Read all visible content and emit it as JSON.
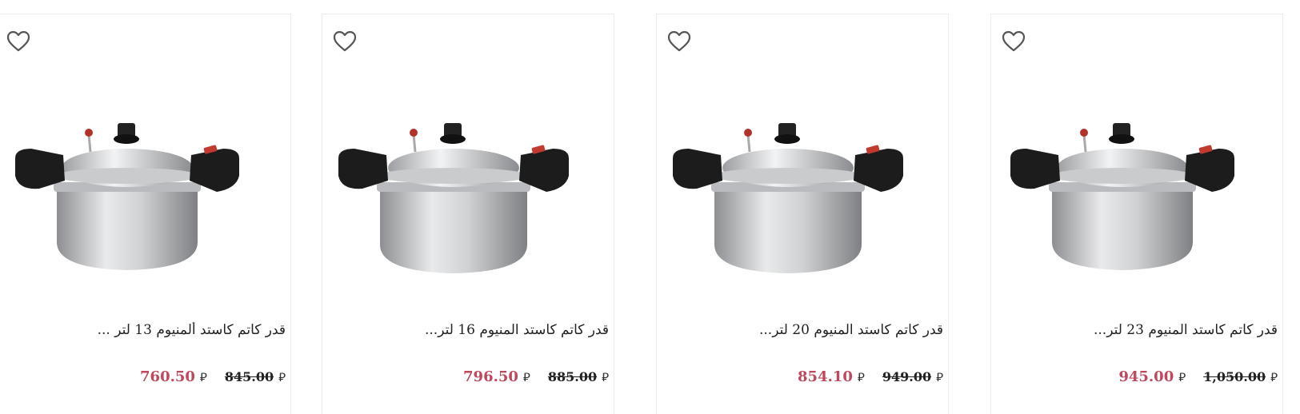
{
  "currency_symbol": "⃁",
  "products": [
    {
      "title": "قدر كاتم كاستد المنيوم 23 لتر...",
      "old_price": "1,050.00",
      "new_price": "945.00"
    },
    {
      "title": "قدر كاتم كاستد المنيوم 20 لتر...",
      "old_price": "949.00",
      "new_price": "854.10"
    },
    {
      "title": "قدر كاتم كاستد المنيوم 16 لتر...",
      "old_price": "885.00",
      "new_price": "796.50"
    },
    {
      "title": "قدر كاتم كاستد ألمنيوم 13 لتر ...",
      "old_price": "845.00",
      "new_price": "760.50"
    }
  ],
  "icons": {
    "wishlist": "heart-outline-icon",
    "currency": "riyal-icon"
  },
  "colors": {
    "sale_price": "#c0485d",
    "old_price": "#222222",
    "card_border": "#ececec"
  }
}
